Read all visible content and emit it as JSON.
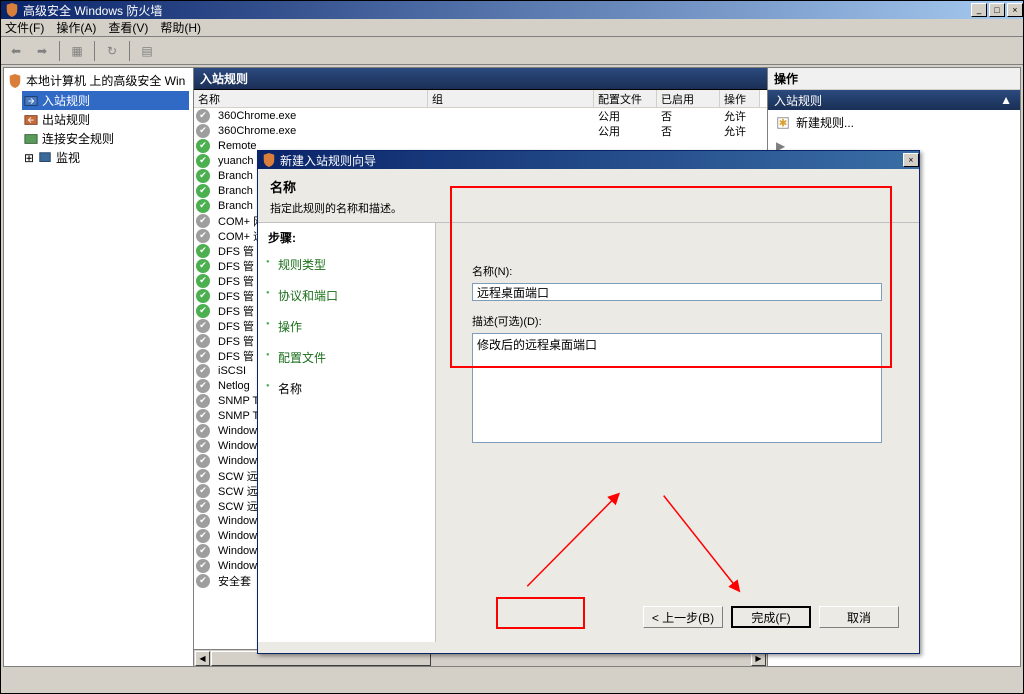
{
  "window": {
    "title": "高级安全 Windows 防火墙"
  },
  "menu": {
    "file": "文件(F)",
    "action": "操作(A)",
    "view": "查看(V)",
    "help": "帮助(H)"
  },
  "tree": {
    "root": "本地计算机 上的高级安全 Win",
    "inbound": "入站规则",
    "outbound": "出站规则",
    "connsec": "连接安全规则",
    "monitor": "监视"
  },
  "list": {
    "header": "入站规则",
    "cols": {
      "name": "名称",
      "group": "组",
      "profile": "配置文件",
      "enabled": "已启用",
      "action": "操作"
    },
    "rows": [
      {
        "i": "gray",
        "name": "360Chrome.exe",
        "profile": "公用",
        "enabled": "否",
        "action": "允许"
      },
      {
        "i": "gray",
        "name": "360Chrome.exe",
        "profile": "公用",
        "enabled": "否",
        "action": "允许"
      },
      {
        "i": "green",
        "name": "Remote",
        "profile": "",
        "enabled": "",
        "action": ""
      },
      {
        "i": "green",
        "name": "yuanch",
        "profile": "",
        "enabled": "",
        "action": ""
      },
      {
        "i": "green",
        "name": "Branch",
        "profile": "",
        "enabled": "",
        "action": ""
      },
      {
        "i": "green",
        "name": "Branch",
        "profile": "",
        "enabled": "",
        "action": ""
      },
      {
        "i": "green",
        "name": "Branch",
        "profile": "",
        "enabled": "",
        "action": ""
      },
      {
        "i": "gray",
        "name": "COM+ 网",
        "profile": "",
        "enabled": "",
        "action": ""
      },
      {
        "i": "gray",
        "name": "COM+ 远",
        "profile": "",
        "enabled": "",
        "action": ""
      },
      {
        "i": "green",
        "name": "DFS 管",
        "profile": "",
        "enabled": "",
        "action": ""
      },
      {
        "i": "green",
        "name": "DFS 管",
        "profile": "",
        "enabled": "",
        "action": ""
      },
      {
        "i": "green",
        "name": "DFS 管",
        "profile": "",
        "enabled": "",
        "action": ""
      },
      {
        "i": "green",
        "name": "DFS 管",
        "profile": "",
        "enabled": "",
        "action": ""
      },
      {
        "i": "green",
        "name": "DFS 管",
        "profile": "",
        "enabled": "",
        "action": ""
      },
      {
        "i": "gray",
        "name": "DFS 管",
        "profile": "",
        "enabled": "",
        "action": ""
      },
      {
        "i": "gray",
        "name": "DFS 管",
        "profile": "",
        "enabled": "",
        "action": ""
      },
      {
        "i": "gray",
        "name": "DFS 管",
        "profile": "",
        "enabled": "",
        "action": ""
      },
      {
        "i": "gray",
        "name": "iSCSI",
        "profile": "",
        "enabled": "",
        "action": ""
      },
      {
        "i": "gray",
        "name": "Netlog",
        "profile": "",
        "enabled": "",
        "action": ""
      },
      {
        "i": "gray",
        "name": "SNMP T",
        "profile": "",
        "enabled": "",
        "action": ""
      },
      {
        "i": "gray",
        "name": "SNMP T",
        "profile": "",
        "enabled": "",
        "action": ""
      },
      {
        "i": "gray",
        "name": "Window",
        "profile": "",
        "enabled": "",
        "action": ""
      },
      {
        "i": "gray",
        "name": "Window",
        "profile": "",
        "enabled": "",
        "action": ""
      },
      {
        "i": "gray",
        "name": "Window",
        "profile": "",
        "enabled": "",
        "action": ""
      },
      {
        "i": "gray",
        "name": "SCW 远",
        "profile": "",
        "enabled": "",
        "action": ""
      },
      {
        "i": "gray",
        "name": "SCW 远",
        "profile": "",
        "enabled": "",
        "action": ""
      },
      {
        "i": "gray",
        "name": "SCW 远",
        "profile": "",
        "enabled": "",
        "action": ""
      },
      {
        "i": "gray",
        "name": "Window",
        "profile": "",
        "enabled": "",
        "action": ""
      },
      {
        "i": "gray",
        "name": "Window",
        "profile": "",
        "enabled": "",
        "action": ""
      },
      {
        "i": "gray",
        "name": "Window",
        "profile": "",
        "enabled": "",
        "action": ""
      },
      {
        "i": "gray",
        "name": "Window",
        "profile": "",
        "enabled": "",
        "action": ""
      },
      {
        "i": "gray",
        "name": "安全套",
        "profile": "",
        "enabled": "",
        "action": ""
      }
    ]
  },
  "actions": {
    "title": "操作",
    "subtitle": "入站规则",
    "new_rule": "新建规则..."
  },
  "wizard": {
    "title": "新建入站规则向导",
    "heading": "名称",
    "subheading": "指定此规则的名称和描述。",
    "steps_label": "步骤:",
    "steps": {
      "type": "规则类型",
      "proto": "协议和端口",
      "action": "操作",
      "profile": "配置文件",
      "name": "名称"
    },
    "name_label": "名称(N):",
    "name_value": "远程桌面端口",
    "desc_label": "描述(可选)(D):",
    "desc_value": "修改后的远程桌面端口",
    "back": "< 上一步(B)",
    "finish": "完成(F)",
    "cancel": "取消"
  }
}
